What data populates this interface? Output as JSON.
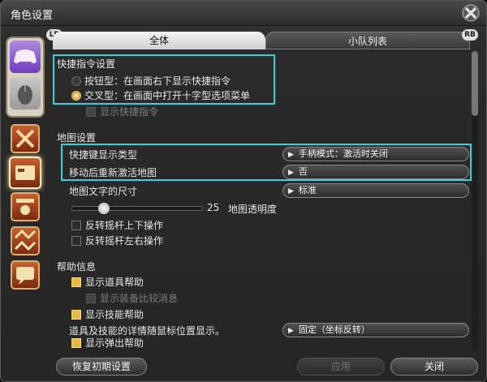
{
  "window": {
    "title": "角色设置"
  },
  "controller": {
    "lb": "LB",
    "rb": "RB"
  },
  "tabs": [
    {
      "label": "全体"
    },
    {
      "label": "小队列表"
    }
  ],
  "shortcut": {
    "header": "快捷指令设置",
    "option1": "按钮型：在画面右下显示快捷指令",
    "option2": "交叉型：在画面中打开十字型选项菜单",
    "show": "显示快捷指令"
  },
  "map": {
    "header": "地图设置",
    "hotkey_label": "快捷键显示类型",
    "hotkey_value": "手柄模式：激活时关闭",
    "reactivate_label": "移动后重新激活地图",
    "reactivate_value": "否",
    "font_size_label": "地图文字的尺寸",
    "font_size_value": "标准",
    "opacity_value": "25",
    "opacity_label": "地图透明度",
    "invert_vertical": "反转摇杆上下操作",
    "invert_horizontal": "反转摇杆左右操作"
  },
  "help": {
    "header": "帮助信息",
    "item_help": "显示道具帮助",
    "gear_compare": "显示装备比较消息",
    "skill_help": "显示技能帮助",
    "tooltip_pos_label": "道具及技能的详情随鼠标位置显示。",
    "tooltip_pos_value": "固定（坐标反转）",
    "popup_help": "显示弹出帮助"
  },
  "buttons": {
    "reset": "恢复初期设置",
    "apply": "应用",
    "close": "关闭"
  },
  "colors": {
    "highlight": "#2fd4dc",
    "checkbox_on": "#e7b846"
  }
}
